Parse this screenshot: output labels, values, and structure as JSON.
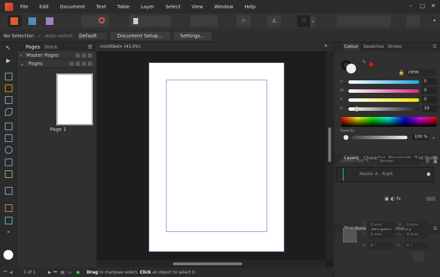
{
  "menu": [
    "File",
    "Edit",
    "Document",
    "Text",
    "Table",
    "Layer",
    "Select",
    "View",
    "Window",
    "Help"
  ],
  "context": {
    "selection": "No Selection",
    "autoselect_label": "Auto-select:",
    "autoselect_value": "Default",
    "doc_setup": "Document Setup...",
    "settings": "Settings..."
  },
  "pages_panel": {
    "tabs": [
      "Pages",
      "Stock"
    ],
    "master_pages": "Master Pages",
    "pages": "Pages",
    "page_label": "Page 1"
  },
  "document": {
    "tab_title": "<Untitled> (43.0%)"
  },
  "colour_panel": {
    "tabs": [
      "Colour",
      "Swatches",
      "Stroke"
    ],
    "model": "CMYK",
    "channels": [
      {
        "label": "C:",
        "value": "0"
      },
      {
        "label": "M:",
        "value": "0"
      },
      {
        "label": "Y:",
        "value": "0"
      },
      {
        "label": "K:",
        "value": "10"
      }
    ],
    "opacity_label": "Opacity",
    "opacity_value": "100 %"
  },
  "layers_panel": {
    "tabs": [
      "Layers",
      "Character",
      "Paragraph",
      "Text Styles"
    ],
    "opacity_label": "Opacity:",
    "opacity_value": "100 %",
    "blend": "Normal",
    "layer_name": "Master A - Right"
  },
  "transform_panel": {
    "tabs": [
      "Transform",
      "Navigator",
      "History"
    ],
    "fields": [
      {
        "label": "X:",
        "value": "0 mm"
      },
      {
        "label": "W:",
        "value": "0 mm"
      },
      {
        "label": "Y:",
        "value": "0 mm"
      },
      {
        "label": "H:",
        "value": "0 mm"
      },
      {
        "label": "R:",
        "value": "0 °"
      },
      {
        "label": "S:",
        "value": "0 °"
      }
    ]
  },
  "status": {
    "page_count": "1 of 1",
    "hint_bold1": "Drag",
    "hint1": " to marquee select. ",
    "hint_bold2": "Click",
    "hint2": " an object to select it."
  }
}
